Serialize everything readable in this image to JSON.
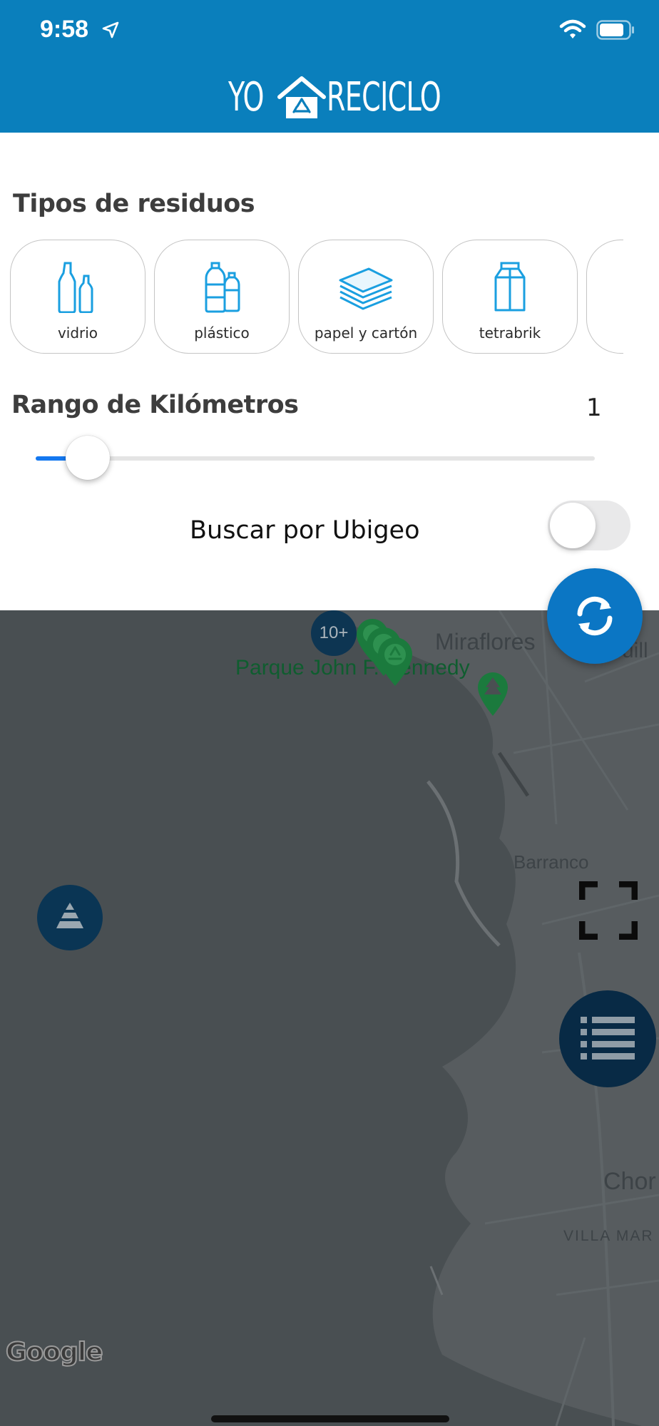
{
  "status_bar": {
    "time": "9:58"
  },
  "brand": {
    "part1": "YO",
    "part2": "RECICLO"
  },
  "filters": {
    "types_title": "Tipos de residuos",
    "types": [
      {
        "label": "vidrio",
        "icon": "glass-bottles-icon"
      },
      {
        "label": "plástico",
        "icon": "plastic-bottles-icon"
      },
      {
        "label": "papel y cartón",
        "icon": "paper-stack-icon"
      },
      {
        "label": "tetrabrik",
        "icon": "carton-icon"
      }
    ],
    "range_title": "Rango de Kilómetros",
    "range_value": "1",
    "range_fill_fraction": 0.1,
    "ubigeo_label": "Buscar por Ubigeo",
    "ubigeo_enabled": false
  },
  "map": {
    "labels": {
      "miraflores": "Miraflores",
      "kennedy": "Parque John F. Kennedy",
      "barranco": "Barranco",
      "chorrillos": "Chor",
      "villa": "VILLA MAR",
      "quillo": "uill"
    },
    "cluster_count": "10+",
    "attribution": "Google"
  },
  "colors": {
    "header": "#0a7fbc",
    "accent_blue": "#1478f0",
    "pin_green": "#1b7a3d",
    "fab_blue": "#0b76c4",
    "fab_navy": "#082a45"
  }
}
